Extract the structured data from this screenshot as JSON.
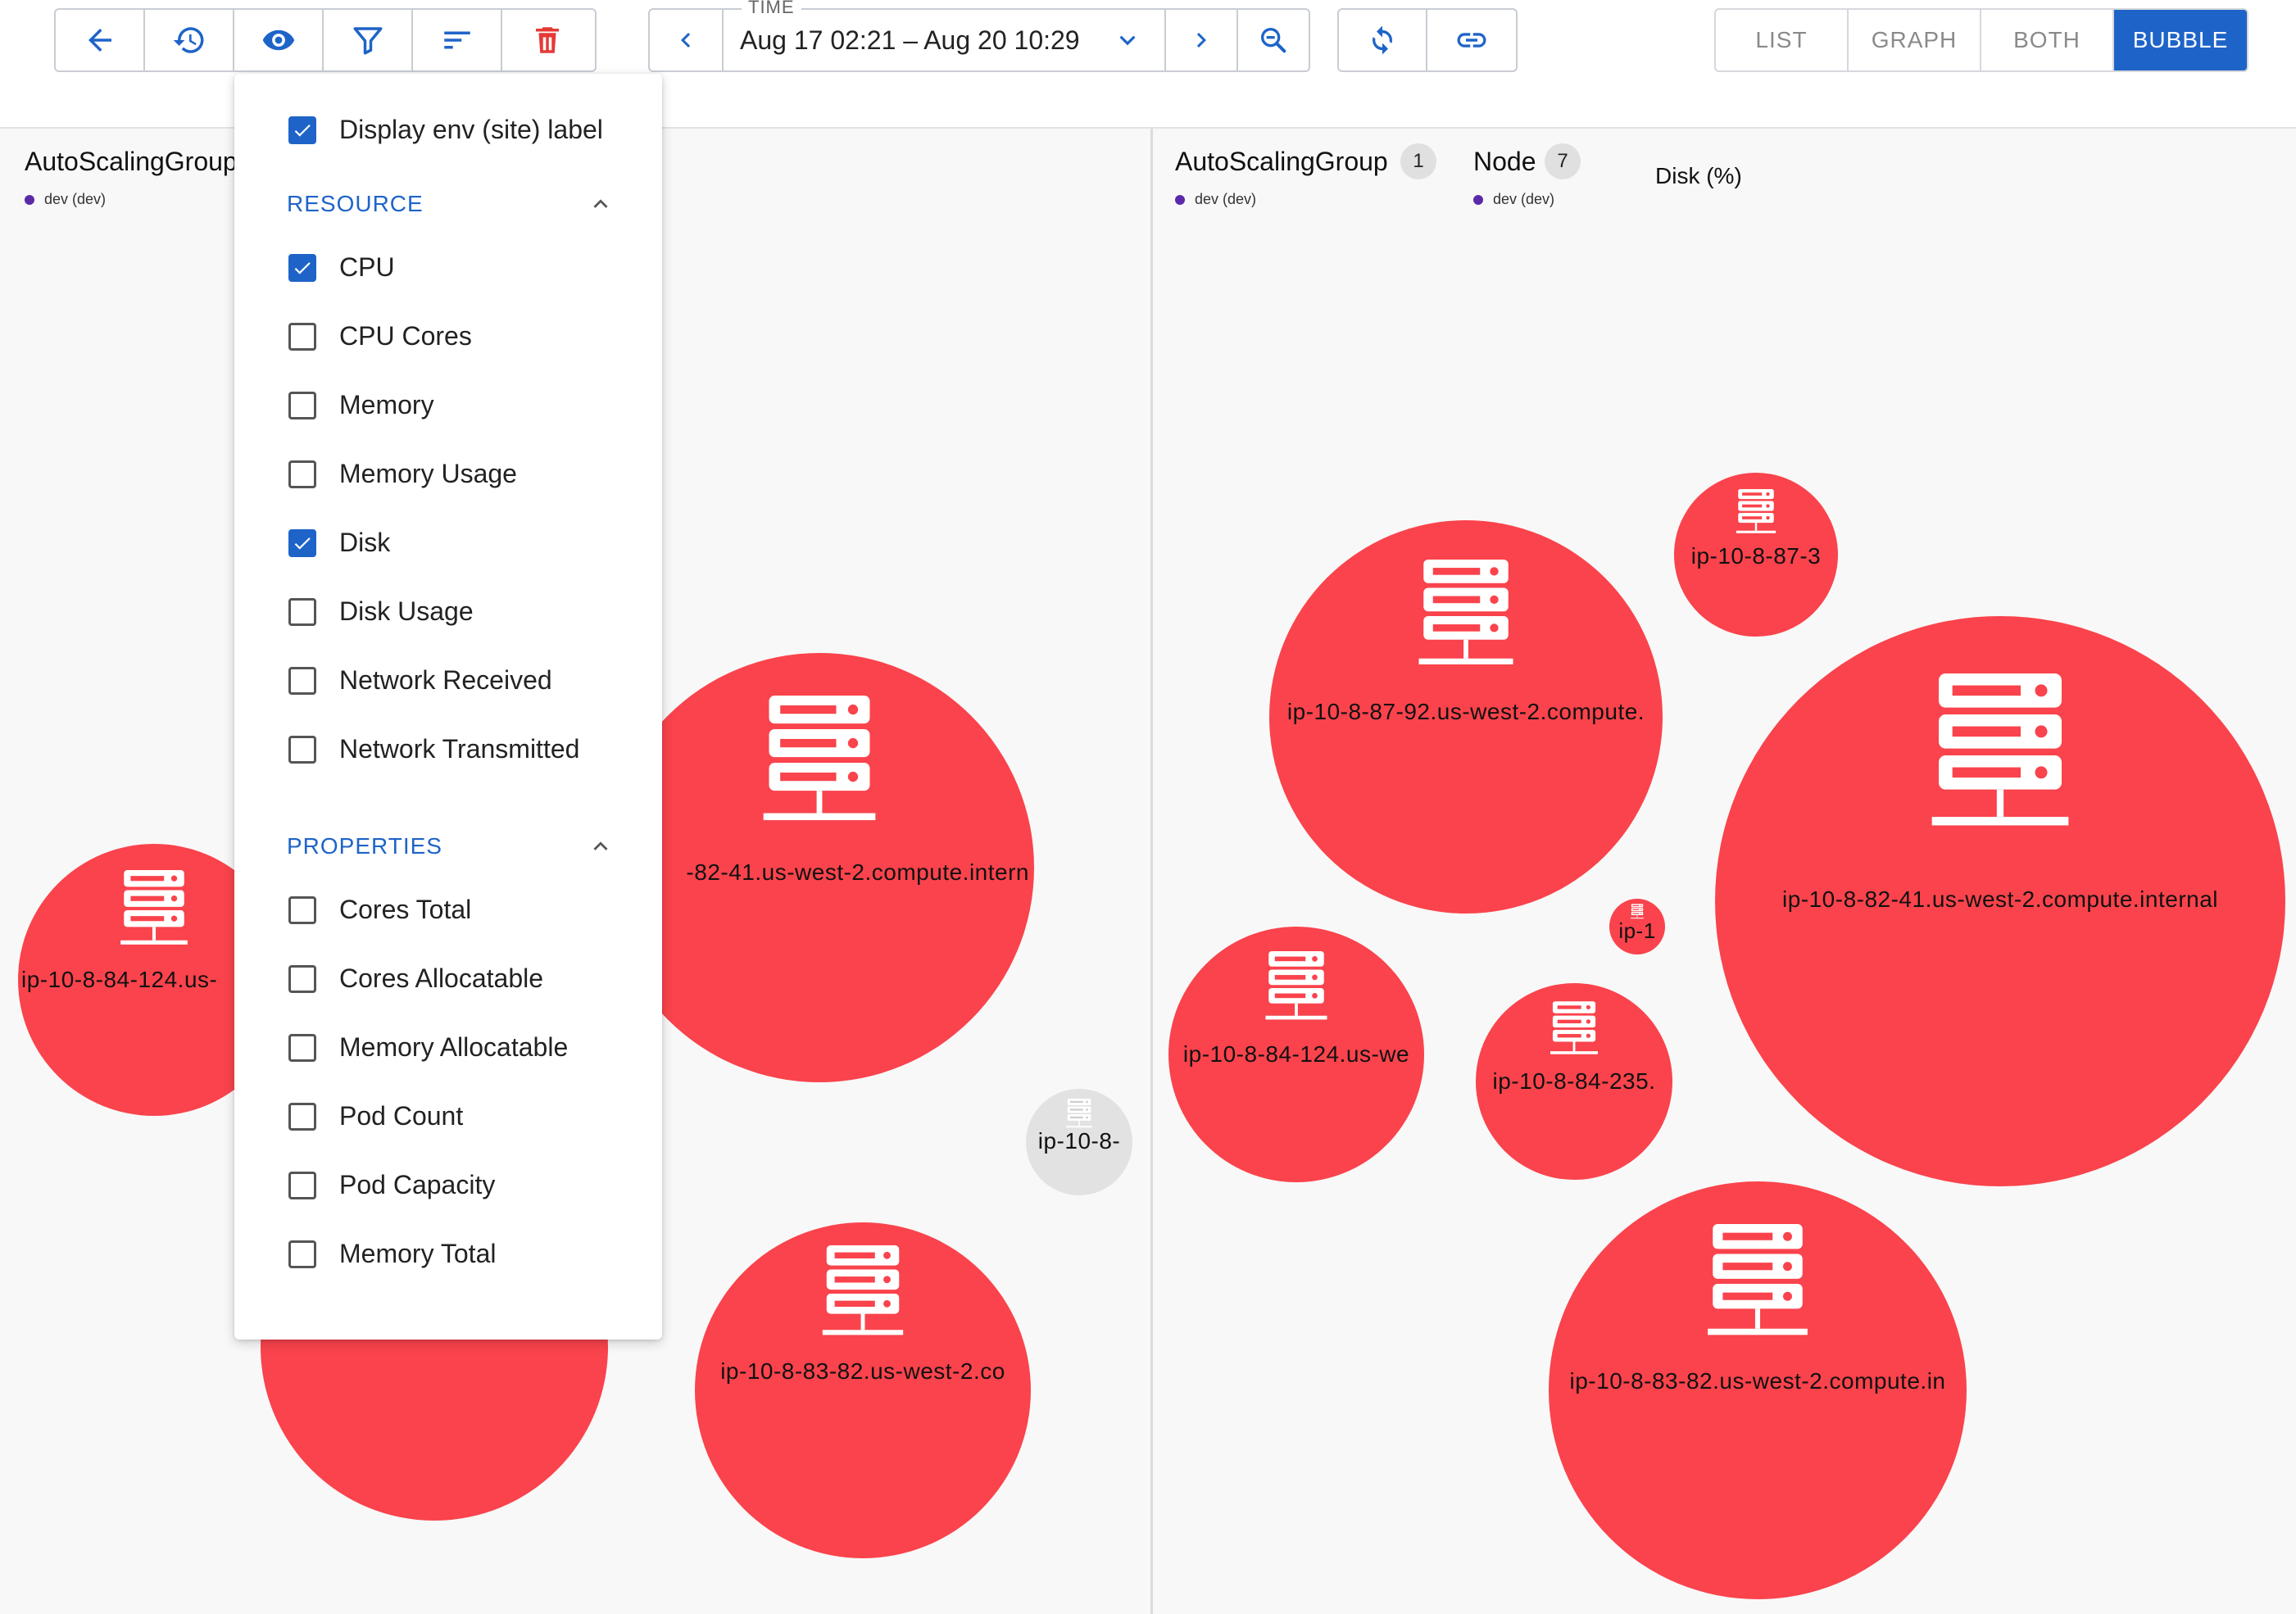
{
  "toolbar": {
    "time_legend": "TIME",
    "time_range": "Aug 17 02:21 – Aug 20 10:29",
    "views": [
      "LIST",
      "GRAPH",
      "BOTH",
      "BUBBLE"
    ],
    "active_view": "BUBBLE",
    "icons": [
      "back-arrow-icon",
      "history-icon",
      "eye-icon",
      "filter-icon",
      "sort-icon",
      "trash-icon",
      "chevron-left-icon",
      "chevron-down-icon",
      "chevron-right-icon",
      "zoom-icon",
      "refresh-icon",
      "link-icon"
    ]
  },
  "left_panel": {
    "title": "AutoScalingGroup",
    "env": "dev (dev)",
    "bubbles": [
      {
        "label": "ip-10-8-84-124.us-",
        "color": "#fa434c"
      },
      {
        "label": "-82-41.us-west-2.compute.intern",
        "color": "#fa434c"
      },
      {
        "label": "ip-10-8-",
        "color": "#e2e2e2"
      },
      {
        "label": "ip-10-8-83-82.us-west-2.co",
        "color": "#fa434c"
      },
      {
        "label": "",
        "color": "#fa434c"
      }
    ]
  },
  "right_panel": {
    "group_title": "AutoScalingGroup",
    "group_count": "1",
    "group_env": "dev (dev)",
    "node_title": "Node",
    "node_count": "7",
    "node_env": "dev (dev)",
    "metric": "Disk (%)",
    "bubbles": [
      {
        "label": "ip-10-8-87-3",
        "color": "#fa434c"
      },
      {
        "label": "ip-10-8-87-92.us-west-2.compute.",
        "color": "#fa434c"
      },
      {
        "label": "ip-10-8-82-41.us-west-2.compute.internal",
        "color": "#fa434c"
      },
      {
        "label": "ip-1",
        "color": "#fa434c"
      },
      {
        "label": "ip-10-8-84-124.us-we",
        "color": "#fa434c"
      },
      {
        "label": "ip-10-8-84-235.",
        "color": "#fa434c"
      },
      {
        "label": "ip-10-8-83-82.us-west-2.compute.in",
        "color": "#fa434c"
      }
    ]
  },
  "menu": {
    "display_env": {
      "label": "Display env (site) label",
      "checked": true
    },
    "resource_title": "RESOURCE",
    "resource": [
      {
        "label": "CPU",
        "checked": true
      },
      {
        "label": "CPU Cores",
        "checked": false
      },
      {
        "label": "Memory",
        "checked": false
      },
      {
        "label": "Memory Usage",
        "checked": false
      },
      {
        "label": "Disk",
        "checked": true
      },
      {
        "label": "Disk Usage",
        "checked": false
      },
      {
        "label": "Network Received",
        "checked": false
      },
      {
        "label": "Network Transmitted",
        "checked": false
      }
    ],
    "properties_title": "PROPERTIES",
    "properties": [
      {
        "label": "Cores Total",
        "checked": false
      },
      {
        "label": "Cores Allocatable",
        "checked": false
      },
      {
        "label": "Memory Allocatable",
        "checked": false
      },
      {
        "label": "Pod Count",
        "checked": false
      },
      {
        "label": "Pod Capacity",
        "checked": false
      },
      {
        "label": "Memory Total",
        "checked": false
      }
    ]
  }
}
